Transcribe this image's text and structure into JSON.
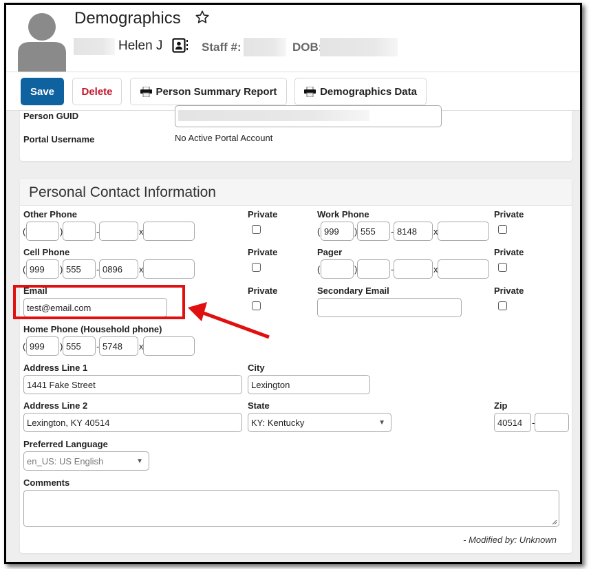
{
  "header": {
    "title": "Demographics",
    "favorite_icon": "star-outline-icon",
    "name": "Helen J",
    "contact_icon": "contact-card-icon",
    "staff_label": "Staff #:",
    "dob_label": "DOB:"
  },
  "toolbar": {
    "save_label": "Save",
    "delete_label": "Delete",
    "person_summary_label": "Person Summary Report",
    "demographics_data_label": "Demographics Data",
    "print_icon": "printer-icon"
  },
  "identity": {
    "guid_label": "Person GUID",
    "portal_label": "Portal Username",
    "portal_value": "No Active Portal Account"
  },
  "contact": {
    "section_title": "Personal Contact Information",
    "private_label": "Private",
    "other_phone": {
      "label": "Other Phone",
      "area": "",
      "prefix": "",
      "line": "",
      "ext": "",
      "private": false
    },
    "work_phone": {
      "label": "Work Phone",
      "area": "999",
      "prefix": "555",
      "line": "8148",
      "ext": "",
      "private": false
    },
    "cell_phone": {
      "label": "Cell Phone",
      "area": "999",
      "prefix": "555",
      "line": "0896",
      "ext": "",
      "private": false
    },
    "pager": {
      "label": "Pager",
      "area": "",
      "prefix": "",
      "line": "",
      "ext": "",
      "private": false
    },
    "email": {
      "label": "Email",
      "value": "test@email.com",
      "private": false
    },
    "secondary_email": {
      "label": "Secondary Email",
      "value": "",
      "private": false
    },
    "home_phone": {
      "label": "Home Phone (Household phone)",
      "area": "999",
      "prefix": "555",
      "line": "5748",
      "ext": ""
    },
    "address1": {
      "label": "Address Line 1",
      "value": "1441  Fake Street"
    },
    "city": {
      "label": "City",
      "value": "Lexington"
    },
    "address2": {
      "label": "Address Line 2",
      "value": "Lexington, KY 40514"
    },
    "state": {
      "label": "State",
      "value": "KY: Kentucky"
    },
    "zip": {
      "label": "Zip",
      "value": "40514",
      "ext": ""
    },
    "language": {
      "label": "Preferred Language",
      "value": "en_US: US English"
    },
    "comments": {
      "label": "Comments",
      "value": ""
    },
    "modified": "- Modified by: Unknown"
  },
  "phone_separators": {
    "open": "(",
    "close": ")",
    "dash": "-",
    "ext": "x"
  },
  "annotation": {
    "color": "#e01010"
  }
}
